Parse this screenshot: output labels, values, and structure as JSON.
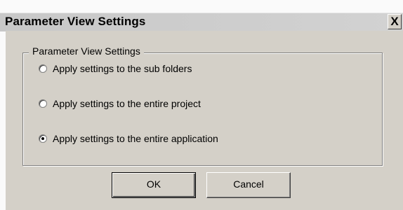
{
  "window": {
    "title": "Parameter View Settings",
    "close_label": "X"
  },
  "group": {
    "caption": "Parameter View Settings",
    "options": [
      {
        "label": "Apply settings to the sub folders",
        "selected": false
      },
      {
        "label": "Apply settings to the entire project",
        "selected": false
      },
      {
        "label": "Apply settings to the entire application",
        "selected": true
      }
    ]
  },
  "buttons": {
    "ok_label": "OK",
    "cancel_label": "Cancel"
  }
}
